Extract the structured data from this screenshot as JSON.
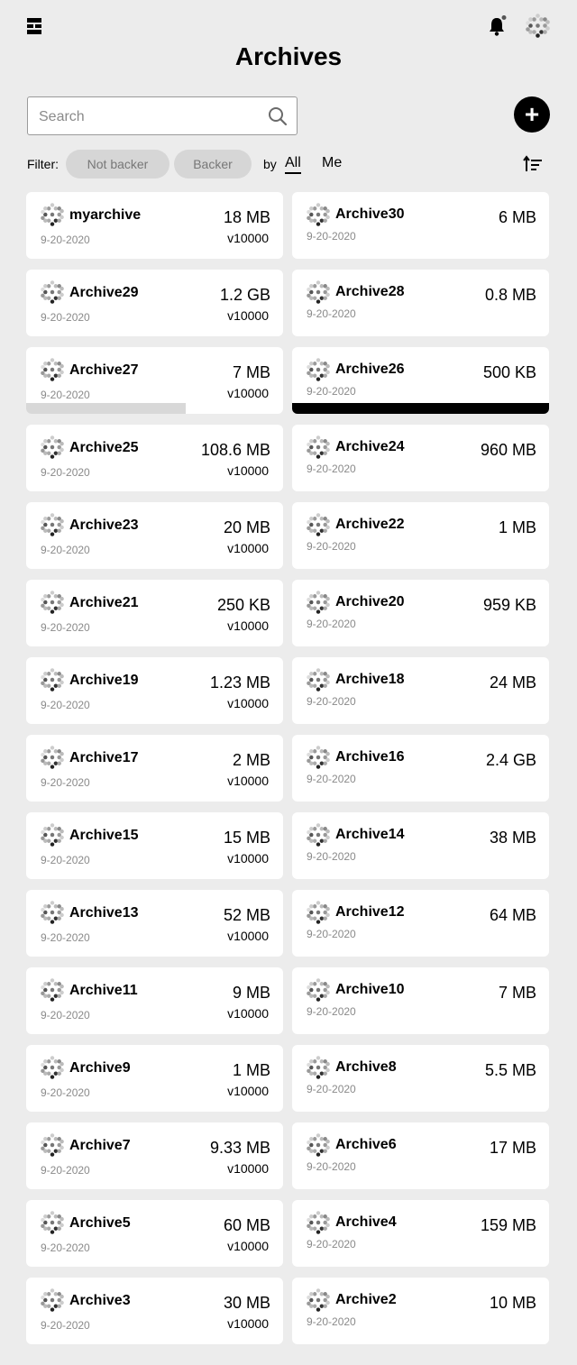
{
  "header": {
    "title": "Archives",
    "menu_icon": "grid-view-icon",
    "bell_icon": "bell-icon",
    "avatar_icon": "avatar-icon"
  },
  "search": {
    "placeholder": "Search"
  },
  "add_button_label": "+",
  "filter": {
    "label": "Filter:",
    "chips": [
      "Not backer",
      "Backer"
    ],
    "by_label": "by",
    "scope_options": [
      "All",
      "Me"
    ],
    "selected_scope": "All"
  },
  "archives": [
    {
      "name": "myarchive",
      "size": "18 MB",
      "date": "9-20-2020",
      "version": "v10000"
    },
    {
      "name": "Archive30",
      "size": "6 MB",
      "date": "9-20-2020"
    },
    {
      "name": "Archive29",
      "size": "1.2 GB",
      "date": "9-20-2020",
      "version": "v10000"
    },
    {
      "name": "Archive28",
      "size": "0.8 MB",
      "date": "9-20-2020"
    },
    {
      "name": "Archive27",
      "size": "7 MB",
      "date": "9-20-2020",
      "version": "v10000",
      "progress": 0.62,
      "progress_color": "#d8d8d8"
    },
    {
      "name": "Archive26",
      "size": "500 KB",
      "date": "9-20-2020",
      "progress": 1.0,
      "progress_color": "#000000"
    },
    {
      "name": "Archive25",
      "size": "108.6 MB",
      "date": "9-20-2020",
      "version": "v10000"
    },
    {
      "name": "Archive24",
      "size": "960 MB",
      "date": "9-20-2020"
    },
    {
      "name": "Archive23",
      "size": "20 MB",
      "date": "9-20-2020",
      "version": "v10000"
    },
    {
      "name": "Archive22",
      "size": "1 MB",
      "date": "9-20-2020"
    },
    {
      "name": "Archive21",
      "size": "250 KB",
      "date": "9-20-2020",
      "version": "v10000"
    },
    {
      "name": "Archive20",
      "size": "959 KB",
      "date": "9-20-2020"
    },
    {
      "name": "Archive19",
      "size": "1.23 MB",
      "date": "9-20-2020",
      "version": "v10000"
    },
    {
      "name": "Archive18",
      "size": "24 MB",
      "date": "9-20-2020"
    },
    {
      "name": "Archive17",
      "size": "2 MB",
      "date": "9-20-2020",
      "version": "v10000"
    },
    {
      "name": "Archive16",
      "size": "2.4 GB",
      "date": "9-20-2020"
    },
    {
      "name": "Archive15",
      "size": "15 MB",
      "date": "9-20-2020",
      "version": "v10000"
    },
    {
      "name": "Archive14",
      "size": "38 MB",
      "date": "9-20-2020"
    },
    {
      "name": "Archive13",
      "size": "52 MB",
      "date": "9-20-2020",
      "version": "v10000"
    },
    {
      "name": "Archive12",
      "size": "64 MB",
      "date": "9-20-2020"
    },
    {
      "name": "Archive11",
      "size": "9 MB",
      "date": "9-20-2020",
      "version": "v10000"
    },
    {
      "name": "Archive10",
      "size": "7 MB",
      "date": "9-20-2020"
    },
    {
      "name": "Archive9",
      "size": "1 MB",
      "date": "9-20-2020",
      "version": "v10000"
    },
    {
      "name": "Archive8",
      "size": "5.5 MB",
      "date": "9-20-2020"
    },
    {
      "name": "Archive7",
      "size": "9.33 MB",
      "date": "9-20-2020",
      "version": "v10000"
    },
    {
      "name": "Archive6",
      "size": "17 MB",
      "date": "9-20-2020"
    },
    {
      "name": "Archive5",
      "size": "60 MB",
      "date": "9-20-2020",
      "version": "v10000"
    },
    {
      "name": "Archive4",
      "size": "159 MB",
      "date": "9-20-2020"
    },
    {
      "name": "Archive3",
      "size": "30 MB",
      "date": "9-20-2020",
      "version": "v10000"
    },
    {
      "name": "Archive2",
      "size": "10 MB",
      "date": "9-20-2020"
    }
  ]
}
